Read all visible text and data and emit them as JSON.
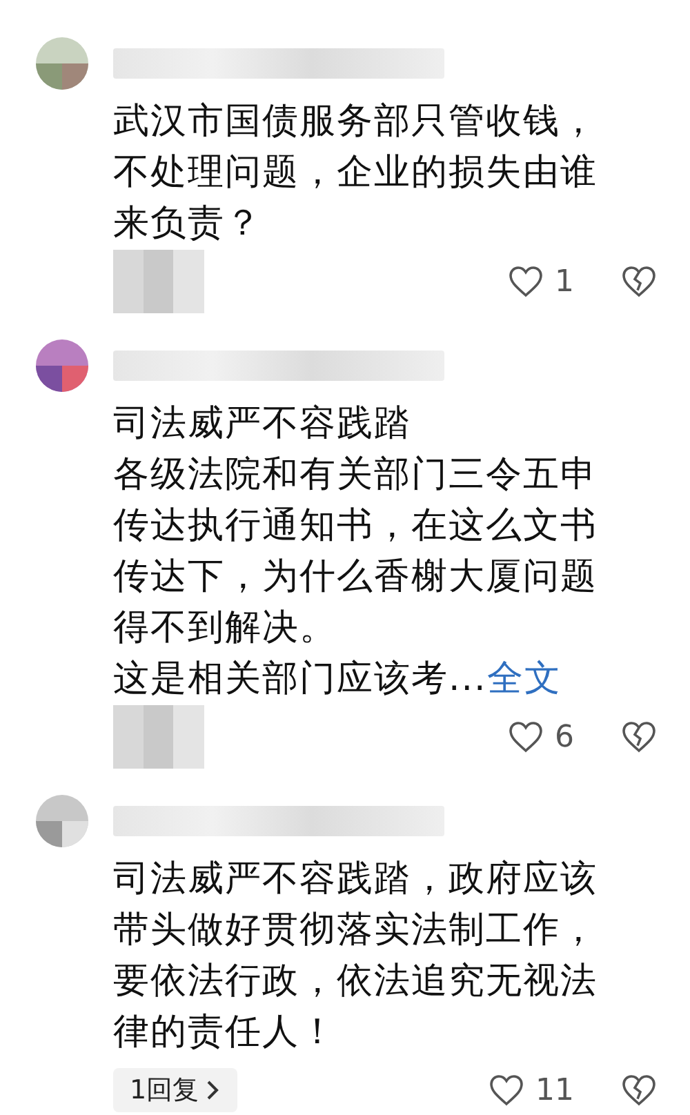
{
  "comments": [
    {
      "lines": [
        "武汉市国债服务部只管收钱，",
        "不处理问题，企业的损失由谁",
        "来负责？"
      ],
      "likes": "1",
      "kind": "blurred"
    },
    {
      "lines": [
        "司法威严不容践踏",
        "各级法院和有关部门三令五申",
        "传达执行通知书，在这么文书",
        "传达下，为什么香榭大厦问题",
        "得不到解决。",
        "这是相关部门应该考..."
      ],
      "more_link": "全文",
      "likes": "6",
      "kind": "blurred"
    },
    {
      "lines": [
        "司法威严不容践踏，政府应该",
        "带头做好贯彻落实法制工作，",
        "要依法行政，依法追究无视法",
        "律的责任人！"
      ],
      "reply_link": "1回复",
      "likes": "11",
      "kind": "reply"
    }
  ]
}
